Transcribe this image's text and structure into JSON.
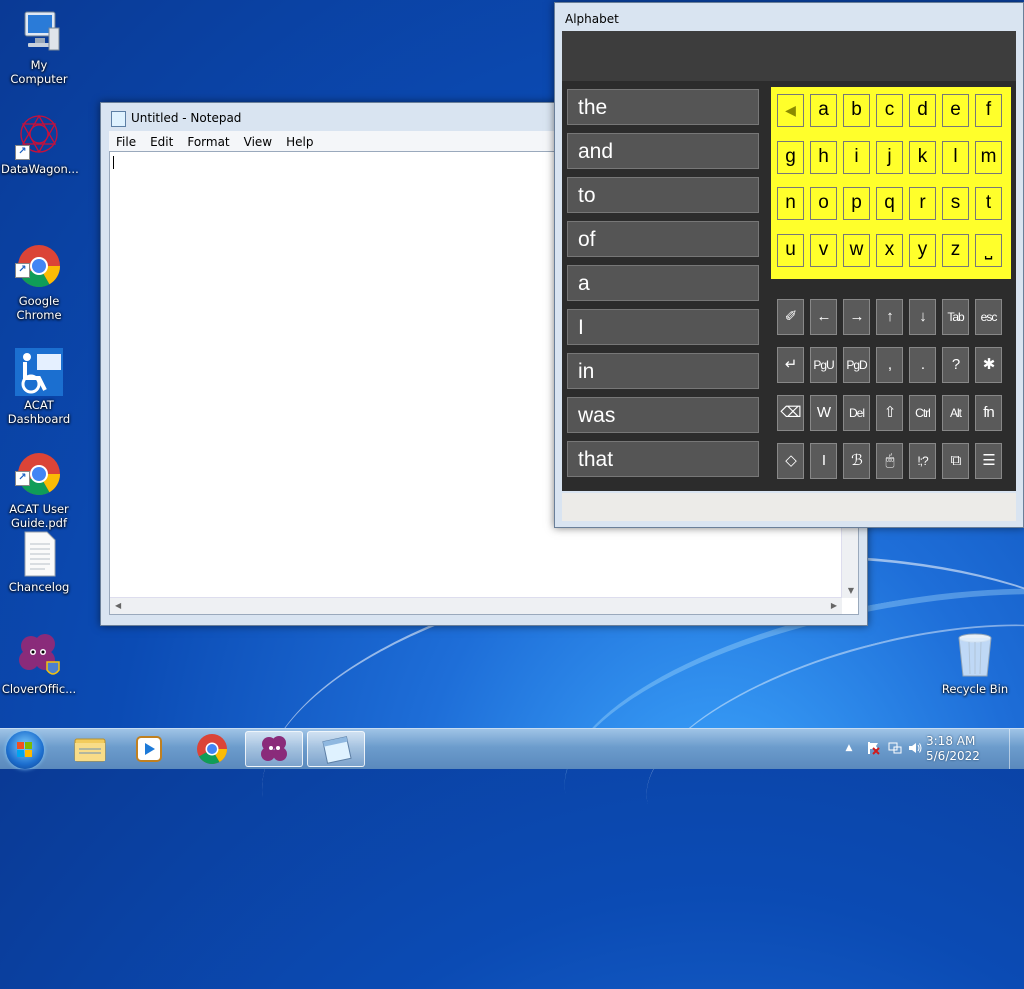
{
  "desktop": {
    "icons": [
      {
        "label": "My Computer",
        "icon": "computer-icon"
      },
      {
        "label": "DataWagon...",
        "icon": "datawagon-icon"
      },
      {
        "label": "Google\nChrome",
        "icon": "chrome-icon"
      },
      {
        "label": "ACAT\nDashboard",
        "icon": "acat-icon"
      },
      {
        "label": "ACAT User\nGuide.pdf",
        "icon": "chrome-icon"
      },
      {
        "label": "Chancelog",
        "icon": "document-icon"
      },
      {
        "label": "CloverOffic...",
        "icon": "clover-icon"
      },
      {
        "label": "Recycle Bin",
        "icon": "recycle-bin-icon"
      }
    ]
  },
  "notepad": {
    "title": "Untitled - Notepad",
    "menu": [
      "File",
      "Edit",
      "Format",
      "View",
      "Help"
    ],
    "content": ""
  },
  "alphabet": {
    "title": "Alphabet",
    "words": [
      "the",
      "and",
      "to",
      "of",
      "a",
      "I",
      "in",
      "was",
      "that"
    ],
    "letters": [
      [
        "◀",
        "a",
        "b",
        "c",
        "d",
        "e",
        "f"
      ],
      [
        "g",
        "h",
        "i",
        "j",
        "k",
        "l",
        "m"
      ],
      [
        "n",
        "o",
        "p",
        "q",
        "r",
        "s",
        "t"
      ],
      [
        "u",
        "v",
        "w",
        "x",
        "y",
        "z",
        "⎵"
      ]
    ],
    "function_keys": [
      [
        "✐",
        "←",
        "→",
        "↑",
        "↓",
        "Tab",
        "esc"
      ],
      [
        "↵",
        "PgU",
        "PgD",
        ",",
        ".",
        "?",
        "✱"
      ],
      [
        "⌫",
        "W",
        "Del",
        "⇧",
        "Ctrl",
        "Alt",
        "fn"
      ],
      [
        "◇",
        "I",
        "ℬ",
        "🖱",
        "!;?",
        "⧉",
        "☰"
      ]
    ]
  },
  "taskbar": {
    "items": [
      "start-orb",
      "file-explorer",
      "media-player",
      "chrome",
      "clover",
      "notepad"
    ],
    "active": "notepad",
    "time": "3:18 AM",
    "date": "5/6/2022"
  }
}
